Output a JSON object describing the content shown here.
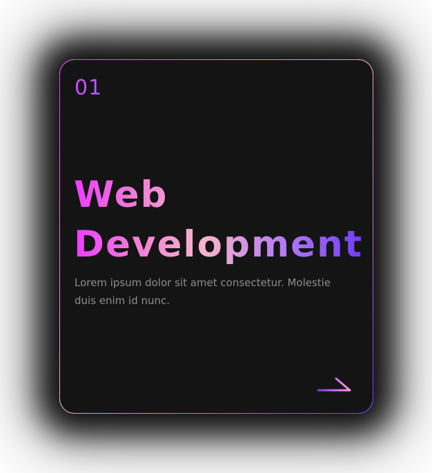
{
  "card": {
    "number": "01",
    "title_line1": "Web",
    "title_line2": "Development",
    "description": "Lorem ipsum dolor sit amet consectetur. Molestie duis enim id nunc.",
    "arrow_icon": "arrow-right-icon"
  },
  "colors": {
    "card_background": "#141414",
    "gradient_start": "#ef3cff",
    "gradient_mid": "#f5b5cc",
    "gradient_end": "#6f3cf6",
    "description_text": "#8d8d8d"
  }
}
